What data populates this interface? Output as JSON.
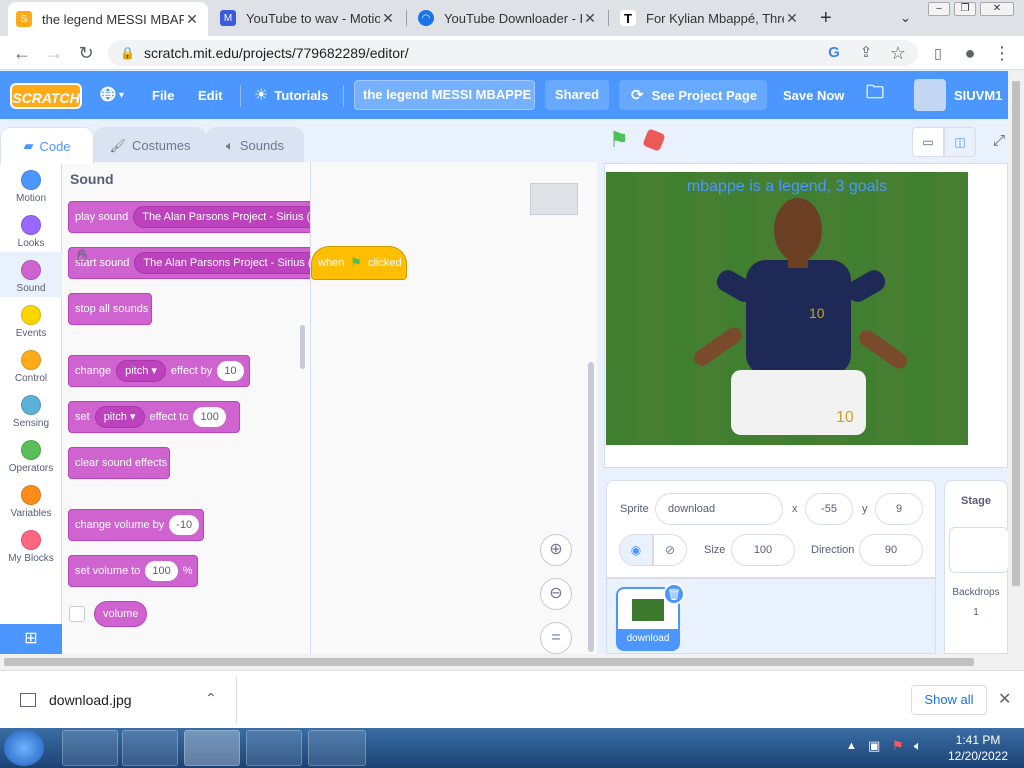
{
  "browser": {
    "tabs": [
      {
        "title": "the legend MESSI MBAPPE",
        "active": true
      },
      {
        "title": "YouTube to wav - Motion",
        "active": false
      },
      {
        "title": "YouTube Downloader - H",
        "active": false
      },
      {
        "title": "For Kylian Mbappé, Three",
        "active": false
      }
    ],
    "url": "scratch.mit.edu/projects/779682289/editor/"
  },
  "menubar": {
    "logo": "SCRATCH",
    "file": "File",
    "edit": "Edit",
    "tutorials": "Tutorials",
    "project_title": "the legend MESSI MBAPPE",
    "shared": "Shared",
    "see_project_page": "See Project Page",
    "save_now": "Save Now",
    "username": "SIUVM1"
  },
  "editor": {
    "tabs": {
      "code": "Code",
      "costumes": "Costumes",
      "sounds": "Sounds"
    },
    "categories": [
      {
        "label": "Motion",
        "color": "#4c97ff"
      },
      {
        "label": "Looks",
        "color": "#9966ff"
      },
      {
        "label": "Sound",
        "color": "#cf63cf"
      },
      {
        "label": "Events",
        "color": "#ffd500"
      },
      {
        "label": "Control",
        "color": "#ffab19"
      },
      {
        "label": "Sensing",
        "color": "#5cb1d6"
      },
      {
        "label": "Operators",
        "color": "#59c059"
      },
      {
        "label": "Variables",
        "color": "#ff8c1a"
      },
      {
        "label": "My Blocks",
        "color": "#ff6680"
      }
    ],
    "palette_heading": "Sound",
    "blocks": {
      "play_sound": "play sound",
      "start_sound": "start sound",
      "sound_name": "The Alan Parsons Project - Sirius (A",
      "stop_all": "stop all sounds",
      "change": "change",
      "pitch": "pitch",
      "effect_by": "effect by",
      "effect_by_value": "10",
      "set": "set",
      "effect_to": "effect to",
      "effect_to_value": "100",
      "clear": "clear sound effects",
      "change_volume": "change volume by",
      "change_volume_value": "-10",
      "set_volume": "set volume to",
      "set_volume_value": "100",
      "percent": "%",
      "volume": "volume"
    },
    "hat_block": {
      "when": "when",
      "clicked": "clicked"
    }
  },
  "stage": {
    "text": "mbappe is a legend, 3 goals"
  },
  "sprite_info": {
    "sprite_label": "Sprite",
    "sprite_name": "download",
    "x_label": "x",
    "x_value": "-55",
    "y_label": "y",
    "y_value": "9",
    "size_label": "Size",
    "size_value": "100",
    "direction_label": "Direction",
    "direction_value": "90",
    "sprite_thumb_name": "download"
  },
  "stage_panel": {
    "title": "Stage",
    "backdrops_label": "Backdrops",
    "backdrops_count": "1"
  },
  "download_bar": {
    "file": "download.jpg",
    "show_all": "Show all"
  },
  "taskbar": {
    "time": "1:41 PM",
    "date": "12/20/2022"
  }
}
